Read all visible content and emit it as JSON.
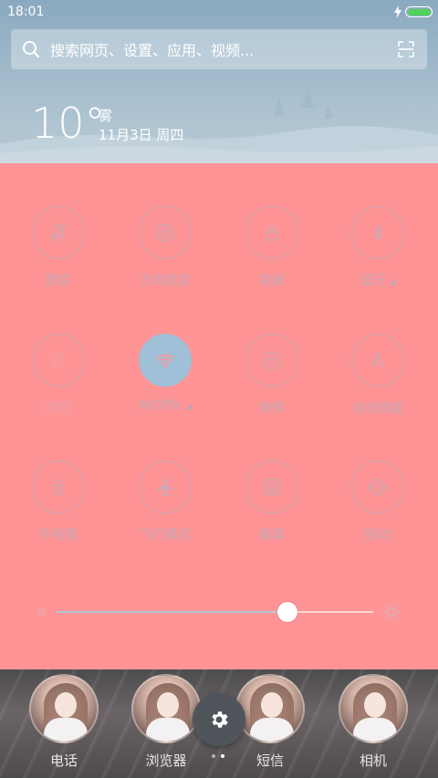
{
  "status_bar": {
    "time": "18:01",
    "icons": [
      "charging-icon",
      "battery-icon"
    ],
    "battery_color": "#52d15a"
  },
  "search": {
    "placeholder": "搜索网页、设置、应用、视频...",
    "icon": "search-icon",
    "scan_icon": "scan-icon"
  },
  "weather": {
    "temperature": "10°",
    "condition": "雾",
    "date": "11月3日 周四"
  },
  "toggles": [
    {
      "label": "静音",
      "icon": "bell-mute-icon",
      "active": false
    },
    {
      "label": "方向锁定",
      "icon": "rotation-lock-icon",
      "active": false
    },
    {
      "label": "锁屏",
      "icon": "lock-icon",
      "active": false
    },
    {
      "label": "蓝牙",
      "icon": "bluetooth-icon",
      "active": false,
      "has_more": true
    },
    {
      "label": "数据",
      "icon": "data-icon",
      "active": false,
      "dim": true
    },
    {
      "label": "MIOffic",
      "icon": "wifi-icon",
      "active": true,
      "has_more": true
    },
    {
      "label": "快传",
      "icon": "share-icon",
      "active": false
    },
    {
      "label": "自动亮度",
      "icon": "auto-brightness-icon",
      "active": false
    },
    {
      "label": "手电筒",
      "icon": "flashlight-icon",
      "active": false
    },
    {
      "label": "飞行模式",
      "icon": "airplane-icon",
      "active": false
    },
    {
      "label": "截屏",
      "icon": "screenshot-icon",
      "active": false
    },
    {
      "label": "振动",
      "icon": "vibrate-icon",
      "active": false
    }
  ],
  "brightness": {
    "level": 0.73
  },
  "dock": {
    "apps": [
      {
        "label": "电话"
      },
      {
        "label": "浏览器"
      },
      {
        "label": "短信"
      },
      {
        "label": "相机"
      }
    ],
    "settings_icon": "gear-icon"
  },
  "colors": {
    "panel": "#fe9496",
    "accent": "#9fc0d6",
    "outline": "#cba9b4"
  }
}
